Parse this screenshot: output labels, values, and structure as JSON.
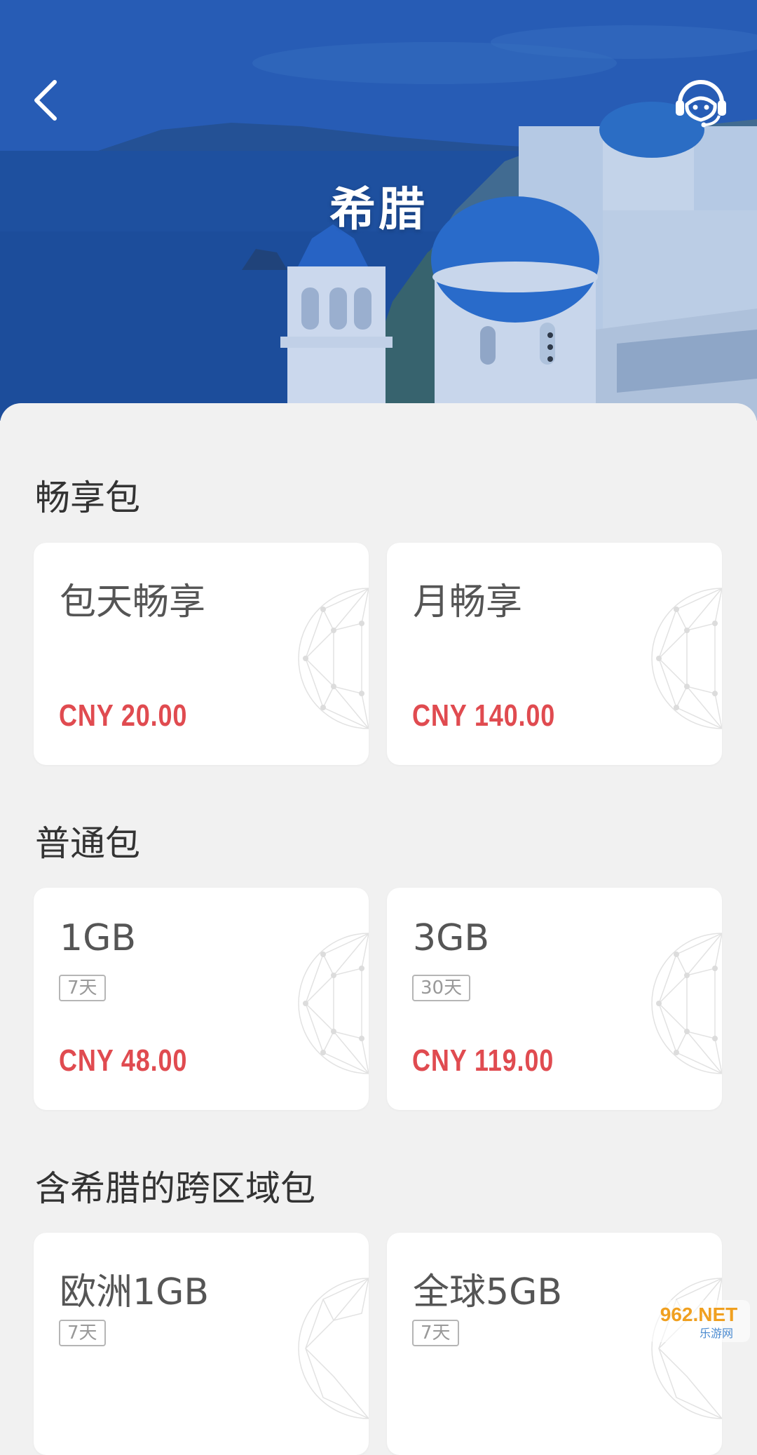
{
  "header": {
    "title": "希腊",
    "back_icon": "chevron-left-icon",
    "support_icon": "customer-service-headset-icon"
  },
  "colors": {
    "price": "#e04b50",
    "hero_blue": "#2c68bb",
    "background": "#f1f1f1"
  },
  "sections": [
    {
      "title": "畅享包",
      "cards": [
        {
          "name": "包天畅享",
          "tag": "",
          "price": "CNY 20.00"
        },
        {
          "name": "月畅享",
          "tag": "",
          "price": "CNY 140.00"
        }
      ]
    },
    {
      "title": "普通包",
      "cards": [
        {
          "name": "1GB",
          "tag": "7天",
          "price": "CNY 48.00"
        },
        {
          "name": "3GB",
          "tag": "30天",
          "price": "CNY 119.00"
        }
      ]
    },
    {
      "title": "含希腊的跨区域包",
      "cards": [
        {
          "name": "欧洲1GB",
          "tag": "7天",
          "price": ""
        },
        {
          "name": "全球5GB",
          "tag": "7天",
          "price": ""
        }
      ]
    }
  ],
  "watermark": {
    "line1": "962.NET",
    "line2": "乐游网"
  }
}
